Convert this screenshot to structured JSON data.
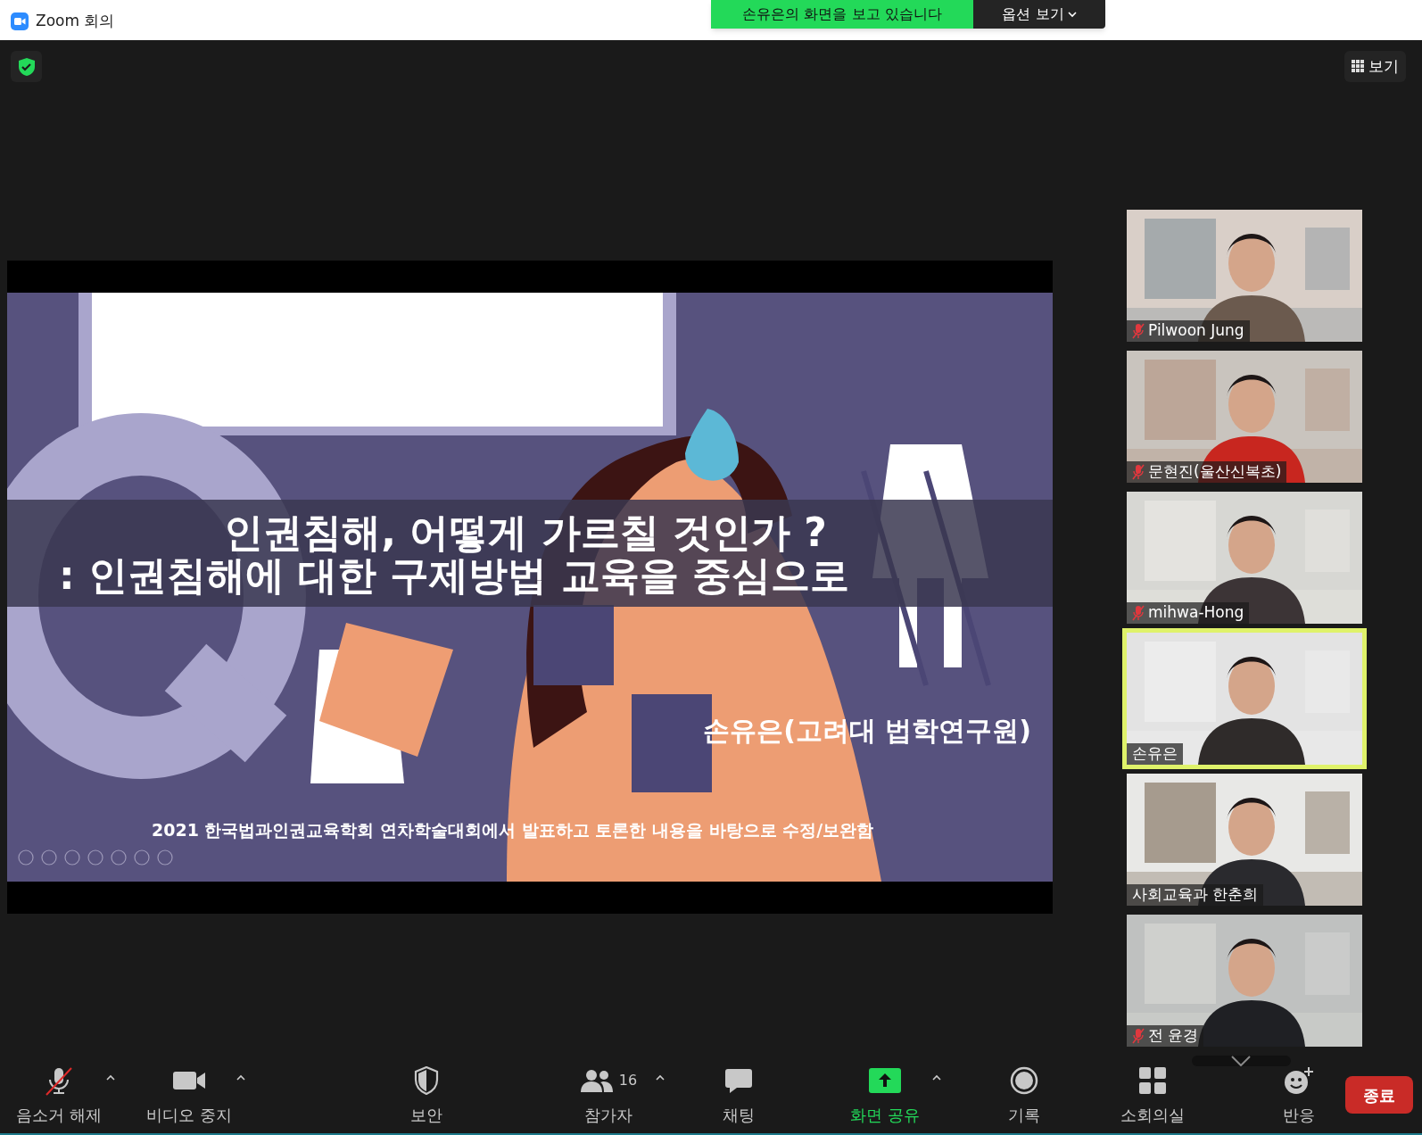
{
  "window": {
    "title": "Zoom 회의"
  },
  "share_banner": {
    "text": "손유은의 화면을 보고 있습니다",
    "options": "옵션 보기"
  },
  "view_button": "보기",
  "slide": {
    "title_lines": [
      "인권침해, 어떻게 가르칠 것인가 ?",
      ": 인권침해에 대한 구제방법 교육을 중심으로"
    ],
    "author": "손유은(고려대 법학연구원)",
    "footer": "2021 한국법과인권교육학회 연차학술대회에서 발표하고 토론한 내용을 바탕으로 수정/보완함"
  },
  "participants": [
    {
      "name": "Pilwoon Jung",
      "muted": true,
      "speaking": false
    },
    {
      "name": "문현진(울산신복초)",
      "muted": true,
      "speaking": false
    },
    {
      "name": "mihwa-Hong",
      "muted": true,
      "speaking": false
    },
    {
      "name": "손유은",
      "muted": false,
      "speaking": true
    },
    {
      "name": "사회교육과 한춘희",
      "muted": false,
      "speaking": false
    },
    {
      "name": "전 윤경",
      "muted": true,
      "speaking": false
    }
  ],
  "toolbar": [
    {
      "kind": "mic",
      "label": "음소거 해제",
      "menu": true,
      "selected": false
    },
    {
      "kind": "video",
      "label": "비디오 중지",
      "menu": true,
      "selected": false
    },
    {
      "kind": "security",
      "label": "보안",
      "menu": false,
      "selected": false
    },
    {
      "kind": "participants",
      "label": "참가자",
      "count": "16",
      "menu": true,
      "selected": false
    },
    {
      "kind": "chat",
      "label": "채팅",
      "menu": false,
      "selected": false
    },
    {
      "kind": "share",
      "label": "화면 공유",
      "menu": true,
      "selected": true
    },
    {
      "kind": "record",
      "label": "기록",
      "menu": false,
      "selected": false
    },
    {
      "kind": "breakout",
      "label": "소회의실",
      "menu": false,
      "selected": false
    },
    {
      "kind": "reactions",
      "label": "반응",
      "menu": false,
      "selected": false
    }
  ],
  "end_button": "종료"
}
